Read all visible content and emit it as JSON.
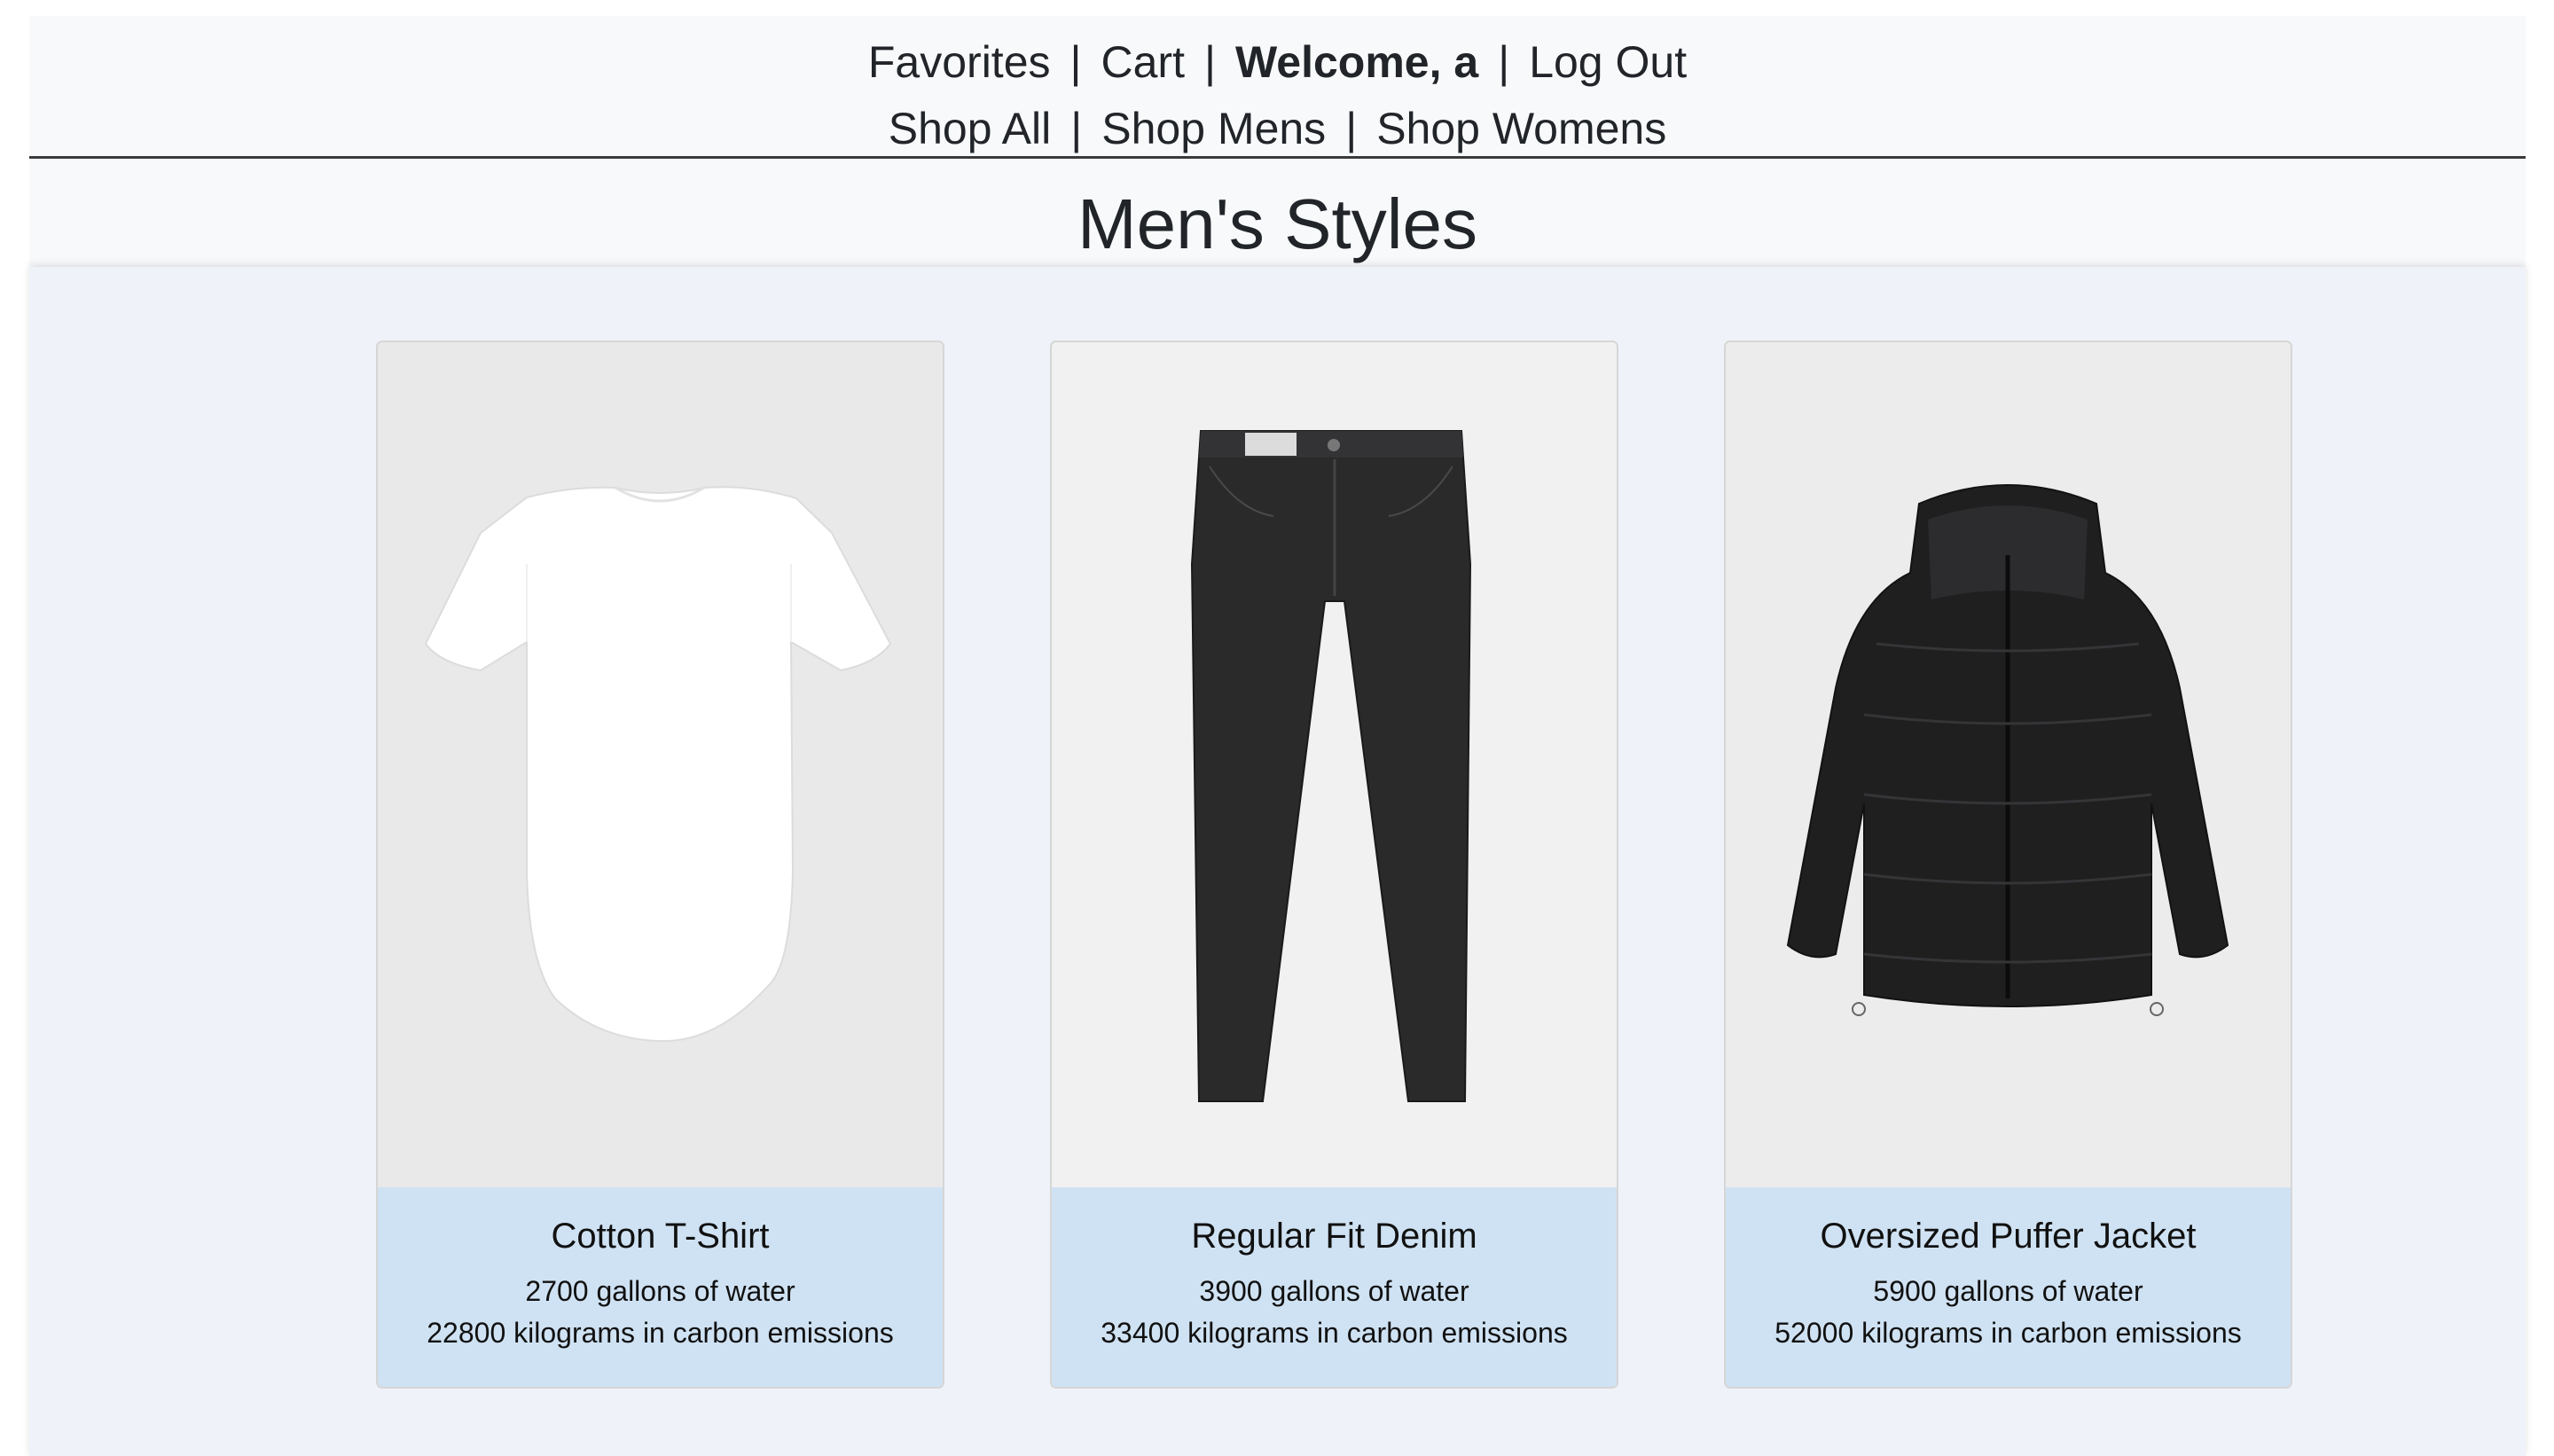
{
  "nav": {
    "favorites": "Favorites",
    "cart": "Cart",
    "welcome": "Welcome, a",
    "logout": "Log Out",
    "shop_all": "Shop All",
    "shop_mens": "Shop Mens",
    "shop_womens": "Shop Womens",
    "separator": "|"
  },
  "page": {
    "title": "Men's Styles"
  },
  "products": [
    {
      "name": "Cotton T-Shirt",
      "water": "2700 gallons of water",
      "carbon": "22800 kilograms in carbon emissions",
      "image": "white-tshirt"
    },
    {
      "name": "Regular Fit Denim",
      "water": "3900 gallons of water",
      "carbon": "33400 kilograms in carbon emissions",
      "image": "black-jeans"
    },
    {
      "name": "Oversized Puffer Jacket",
      "water": "5900 gallons of water",
      "carbon": "52000 kilograms in carbon emissions",
      "image": "black-puffer-jacket"
    }
  ],
  "colors": {
    "background": "#f8f9fa",
    "product_area": "#eff3f9",
    "card_footer": "#cfe2f3",
    "text": "#212529"
  }
}
